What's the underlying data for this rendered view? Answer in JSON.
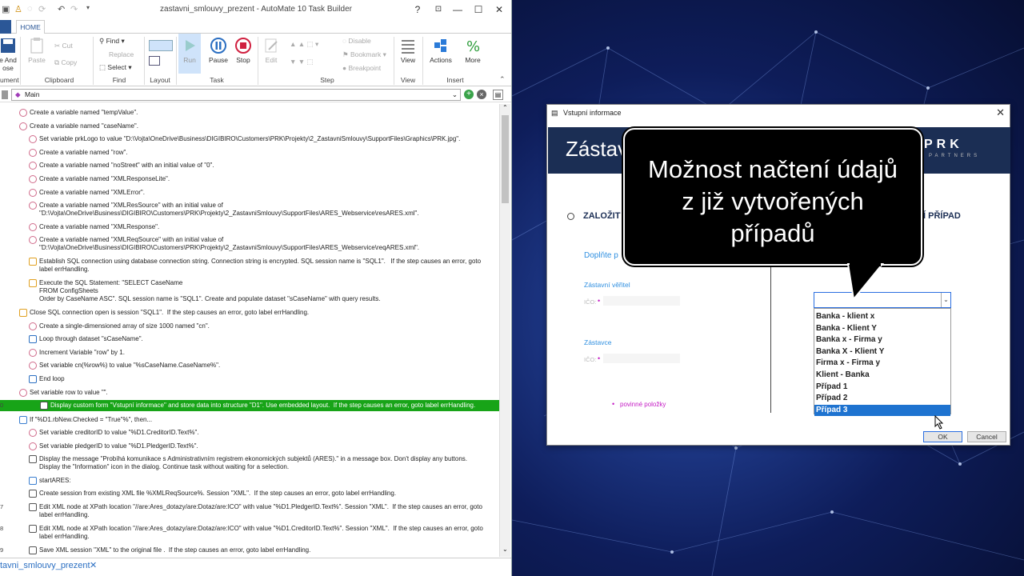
{
  "window": {
    "title": "zastavni_smlouvy_prezent - AutoMate 10 Task Builder",
    "help": "?",
    "minimize": "—",
    "maximize": "☐",
    "close": "✕"
  },
  "ribbon": {
    "file_tab": "",
    "home_tab": "HOME",
    "save_label_1": "e And",
    "save_label_2": "ose",
    "paste": "Paste",
    "cut": "Cut",
    "copy": "Copy",
    "find": "Find",
    "replace": "Replace",
    "select": "Select",
    "run": "Run",
    "pause": "Pause",
    "stop": "Stop",
    "edit": "Edit",
    "disable": "Disable",
    "bookmark": "Bookmark",
    "breakpoint": "Breakpoint",
    "view": "View",
    "actions": "Actions",
    "more": "More",
    "groups": {
      "document": "ument",
      "clipboard": "Clipboard",
      "find": "Find",
      "layout": "Layout",
      "task": "Task",
      "step": "Step",
      "view": "View",
      "insert": "Insert"
    }
  },
  "task_selector": {
    "value": "Main"
  },
  "steps": [
    {
      "num": "",
      "text": "Create a variable named \"tempValue\"."
    },
    {
      "num": "",
      "text": "Create a variable named \"caseName\"."
    },
    {
      "num": "",
      "text": "Set variable prkLogo to value \"D:\\Vojta\\OneDrive\\Business\\DIGIBIRO\\Customers\\PRK\\Projekty\\2_ZastavniSmlouvy\\SupportFiles\\Graphics\\PRK.jpg\"."
    },
    {
      "num": "",
      "text": "Create a variable named \"row\"."
    },
    {
      "num": "",
      "text": "Create a variable named \"noStreet\" with an initial value of \"0\"."
    },
    {
      "num": "",
      "text": "Create a variable named \"XMLResponseLite\"."
    },
    {
      "num": "",
      "text": "Create a variable named \"XMLError\"."
    },
    {
      "num": "",
      "text": "Create a variable named \"XMLResSource\" with an initial value of\n\"D:\\Vojta\\OneDrive\\Business\\DIGIBIRO\\Customers\\PRK\\Projekty\\2_ZastavniSmlouvy\\SupportFiles\\ARES_Webservice\\resARES.xml\"."
    },
    {
      "num": "",
      "text": "Create a variable named \"XMLResponse\"."
    },
    {
      "num": "",
      "text": "Create a variable named \"XMLReqSource\" with an initial value of\n\"D:\\Vojta\\OneDrive\\Business\\DIGIBIRO\\Customers\\PRK\\Projekty\\2_ZastavniSmlouvy\\SupportFiles\\ARES_Webservice\\reqARES.xml\"."
    },
    {
      "num": "",
      "text": "Establish SQL connection using database connection string. Connection string is encrypted. SQL session name is \"SQL1\".   If the step causes an error, goto\nlabel errHandling."
    },
    {
      "num": "",
      "text": "Execute the SQL Statement: \"SELECT CaseName\nFROM ConfigSheets\nOrder by CaseName ASC\". SQL session name is \"SQL1\". Create and populate dataset \"sCaseName\" with query results."
    },
    {
      "num": "",
      "text": "Close SQL connection open is session \"SQL1\".  If the step causes an error, goto label errHandling."
    },
    {
      "num": "",
      "text": "Create a single-dimensioned array of size 1000 named \"cn\"."
    },
    {
      "num": "",
      "text": "Loop through dataset \"sCaseName\"."
    },
    {
      "num": "",
      "text": "Increment Variable \"row\" by 1."
    },
    {
      "num": "",
      "text": "Set variable cn(%row%) to value \"%sCaseName.CaseName%\"."
    },
    {
      "num": "",
      "text": "End loop"
    },
    {
      "num": "",
      "text": "Set variable row to value \"\"."
    },
    {
      "num": "0",
      "text": "Display custom form \"Vstupní informace\" and store data into structure \"D1\". Use embedded layout.  If the step causes an error, goto label errHandling."
    },
    {
      "num": "",
      "text": "If \"%D1.rbNew.Checked = \"True\"%\", then..."
    },
    {
      "num": "",
      "text": "Set variable creditorID to value \"%D1.CreditorID.Text%\"."
    },
    {
      "num": "",
      "text": "Set variable pledgerID to value \"%D1.PledgerID.Text%\"."
    },
    {
      "num": "",
      "text": "Display the message \"Probíhá komunikace s Administrativním registrem ekonomických subjektů (ARES).\" in a message box. Don't display any buttons.\nDisplay the \"Information\" icon in the dialog. Continue task without waiting for a selection."
    },
    {
      "num": "",
      "text": "startARES:"
    },
    {
      "num": "",
      "text": "Create session from existing XML file %XMLReqSource%. Session \"XML\".  If the step causes an error, goto label errHandling."
    },
    {
      "num": "7",
      "text": "Edit XML node at XPath location \"//are:Ares_dotazy/are:Dotaz/are:ICO\" with value \"%D1.PledgerID.Text%\". Session \"XML\".  If the step causes an error, goto\nlabel errHandling."
    },
    {
      "num": "8",
      "text": "Edit XML node at XPath location \"//are:Ares_dotazy/are:Dotaz/are:ICO\" with value \"%D1.CreditorID.Text%\". Session \"XML\".  If the step causes an error, goto\nlabel errHandling."
    },
    {
      "num": "9",
      "text": "Save XML session \"XML\" to the original file .  If the step causes an error, goto label errHandling."
    }
  ],
  "doc_tab": {
    "label": "tavni_smlouvy_prezent",
    "close": "✕"
  },
  "dialog": {
    "title": "Vstupní informace",
    "close": "✕",
    "banner_title": "Zástav",
    "logo": "PRK",
    "logo_sub": "PARTNERS",
    "option_new": "ZALOŽIT",
    "option_existing": "Í PŘÍPAD",
    "hint": "Doplňte p",
    "creditor_label": "Zástavní věřitel",
    "ico_label_1": "IČO:",
    "pledger_label": "Zástavce",
    "ico_label_2": "IČO:",
    "required_note": "povinné položky",
    "required_mark": "•",
    "combo_value": "",
    "combo_arrow": "⌄",
    "options": [
      "Banka - klient x",
      "Banka - Klient Y",
      "Banka x - Firma y",
      "Banka X - Klient Y",
      "Firma x - Firma y",
      "Klient - Banka",
      "Případ 1",
      "Případ 2",
      "Případ 3"
    ],
    "selected_index": 8,
    "ok": "OK",
    "cancel": "Cancel"
  },
  "callout": {
    "line1": "Možnost načtení údajů",
    "line2": "z již vytvořených",
    "line3": "případů"
  }
}
